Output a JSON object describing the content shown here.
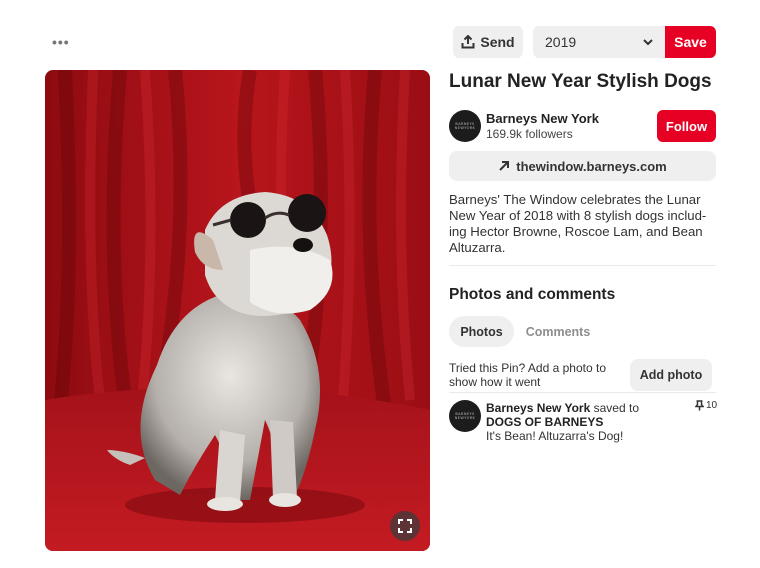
{
  "header": {
    "more_label": "•••"
  },
  "toolbar": {
    "send_label": "Send",
    "board_selected": "2019",
    "save_label": "Save"
  },
  "pin": {
    "title": "Lunar New Year Stylish Dogs",
    "description": "Barneys' The Window celebrates the Lunar New Year of 2018 with 8 stylish dogs includ-ing Hector Browne, Roscoe Lam, and Bean Altuzarra.",
    "link_text": "thewindow.barneys.com"
  },
  "creator": {
    "name": "Barneys New York",
    "followers": "169.9k followers",
    "follow_label": "Follow",
    "avatar_text": "BARNEYS NEWYORK"
  },
  "photos_section": {
    "title": "Photos and comments",
    "tabs": [
      {
        "label": "Photos",
        "active": true
      },
      {
        "label": "Comments",
        "active": false
      }
    ],
    "prompt": "Tried this Pin? Add a photo to show how it went",
    "add_photo_label": "Add photo"
  },
  "activity": {
    "user": "Barneys New York",
    "action": "saved to",
    "board": "DOGS OF BARNEYS",
    "text": "It's Bean! Altuzarra's Dog!",
    "pin_count": "10"
  },
  "colors": {
    "accent": "#e60023",
    "button_gray": "#efefef",
    "curtain_red": "#b3141a"
  },
  "icons": {
    "send": "share-upload-icon",
    "board_dropdown": "chevron-down-icon",
    "link": "arrow-up-right-icon",
    "expand": "expand-icon",
    "pin": "pushpin-icon"
  }
}
